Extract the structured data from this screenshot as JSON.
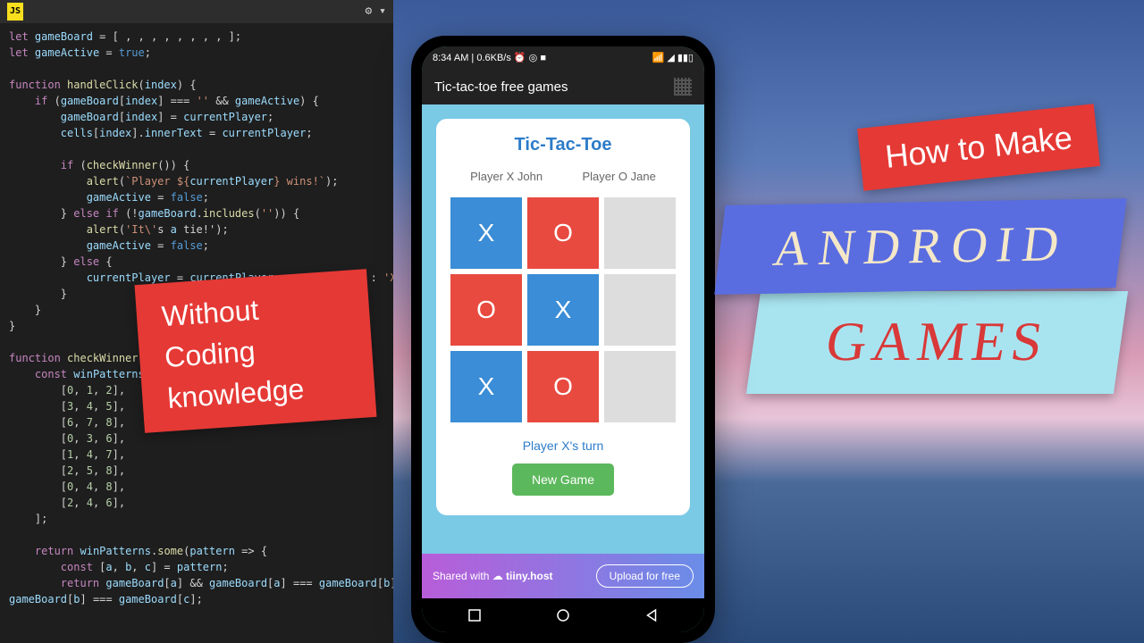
{
  "editor": {
    "tab_label": "JS",
    "code_lines": [
      "let gameBoard = [ , , , , , , , , ];",
      "let gameActive = true;",
      "",
      "function handleClick(index) {",
      "    if (gameBoard[index] === '' && gameActive) {",
      "        gameBoard[index] = currentPlayer;",
      "        cells[index].innerText = currentPlayer;",
      "",
      "        if (checkWinner()) {",
      "            alert(`Player ${currentPlayer} wins!`);",
      "            gameActive = false;",
      "        } else if (!gameBoard.includes('')) {",
      "            alert('It\\'s a tie!');",
      "            gameActive = false;",
      "        } else {",
      "            currentPlayer = currentPlayer === 'X' ? 'O' : 'X';",
      "        }",
      "    }",
      "}",
      "",
      "function checkWinner() {",
      "    const winPatterns = [",
      "        [0, 1, 2],",
      "        [3, 4, 5],",
      "        [6, 7, 8],",
      "        [0, 3, 6],",
      "        [1, 4, 7],",
      "        [2, 5, 8],",
      "        [0, 4, 8],",
      "        [2, 4, 6],",
      "    ];",
      "",
      "    return winPatterns.some(pattern => {",
      "        const [a, b, c] = pattern;",
      "        return gameBoard[a] && gameBoard[a] === gameBoard[b] &&",
      "gameBoard[b] === gameBoard[c];"
    ]
  },
  "phone": {
    "status_time": "8:34 AM | 0.6KB/s",
    "app_title": "Tic-tac-toe free games",
    "game": {
      "title": "Tic-Tac-Toe",
      "player_x": "Player X John",
      "player_o": "Player O Jane",
      "cells": [
        "X",
        "O",
        "",
        "O",
        "X",
        "",
        "X",
        "O",
        ""
      ],
      "turn": "Player X's turn",
      "new_game": "New Game"
    },
    "hosting": {
      "shared": "Shared with",
      "brand": "tiiny.host",
      "upload": "Upload for free"
    }
  },
  "overlays": {
    "without": "Without\nCoding\nknowledge",
    "howto": "How to Make",
    "android": "ANDROID",
    "games": "GAMES"
  }
}
